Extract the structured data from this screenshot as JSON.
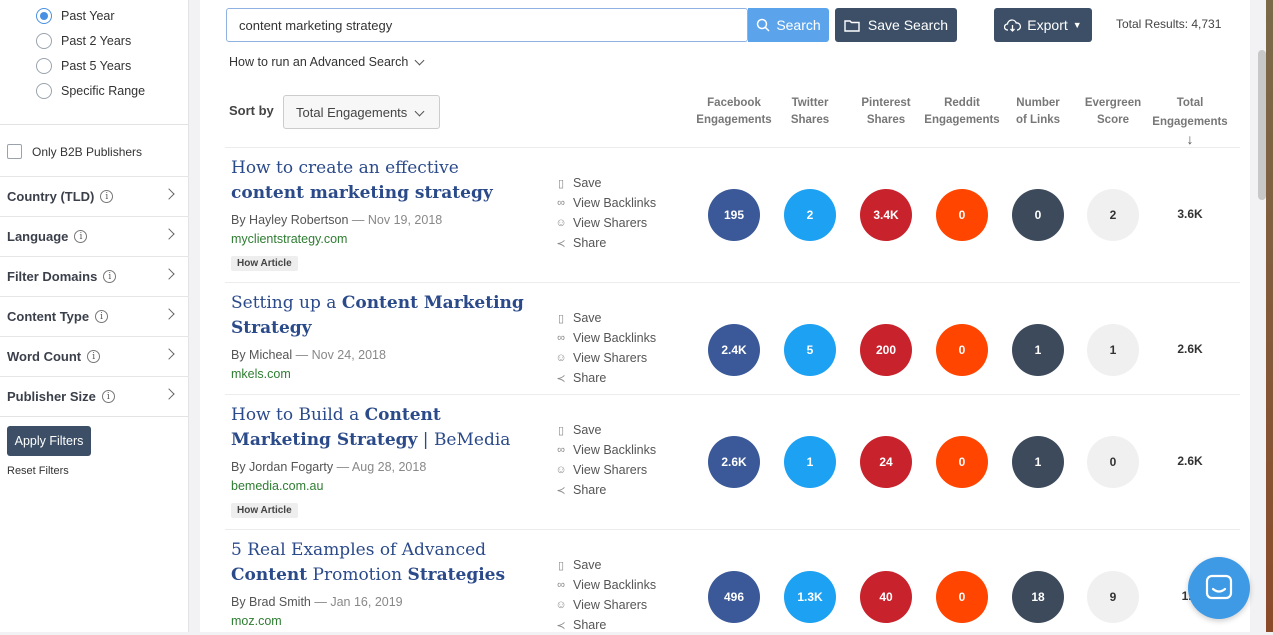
{
  "sidebar": {
    "date_options": [
      {
        "label": "Past Year",
        "checked": true
      },
      {
        "label": "Past 2 Years",
        "checked": false
      },
      {
        "label": "Past 5 Years",
        "checked": false
      },
      {
        "label": "Specific Range",
        "checked": false
      }
    ],
    "b2b_label": "Only B2B Publishers",
    "filters": [
      "Country (TLD)",
      "Language",
      "Filter Domains",
      "Content Type",
      "Word Count",
      "Publisher Size"
    ],
    "apply_label": "Apply Filters",
    "reset_label": "Reset Filters"
  },
  "search": {
    "query": "content marketing strategy",
    "search_label": "Search",
    "save_search_label": "Save Search",
    "export_label": "Export",
    "total_results": "Total Results: 4,731",
    "advanced_label": "How to run an Advanced Search"
  },
  "sort": {
    "label": "Sort by",
    "selected": "Total Engagements"
  },
  "columns": [
    {
      "line1": "Facebook",
      "line2": "Engagements"
    },
    {
      "line1": "Twitter",
      "line2": "Shares"
    },
    {
      "line1": "Pinterest",
      "line2": "Shares"
    },
    {
      "line1": "Reddit",
      "line2": "Engagements"
    },
    {
      "line1": "Number",
      "line2": "of Links"
    },
    {
      "line1": "Evergreen",
      "line2": "Score"
    },
    {
      "line1": "Total",
      "line2": "Engagements"
    }
  ],
  "actions": [
    "Save",
    "View Backlinks",
    "View Sharers",
    "Share"
  ],
  "results": [
    {
      "title_parts": [
        {
          "t": "How to create an effective ",
          "b": false
        },
        {
          "t": "content marketing strategy",
          "b": true
        }
      ],
      "author": "By Hayley Robertson",
      "date": "— Nov 19, 2018",
      "domain": "myclientstrategy.com",
      "tag": "How Article",
      "metrics": [
        "195",
        "2",
        "3.4K",
        "0",
        "0",
        "2",
        "3.6K"
      ]
    },
    {
      "title_parts": [
        {
          "t": "Setting up a ",
          "b": false
        },
        {
          "t": "Content Marketing Strategy",
          "b": true
        }
      ],
      "author": "By Micheal",
      "date": "— Nov 24, 2018",
      "domain": "mkels.com",
      "tag": "",
      "metrics": [
        "2.4K",
        "5",
        "200",
        "0",
        "1",
        "1",
        "2.6K"
      ]
    },
    {
      "title_parts": [
        {
          "t": "How to Build a ",
          "b": false
        },
        {
          "t": "Content Marketing Strategy",
          "b": true
        },
        {
          "t": " | BeMedia",
          "b": false
        }
      ],
      "author": "By Jordan Fogarty",
      "date": "— Aug 28, 2018",
      "domain": "bemedia.com.au",
      "tag": "How Article",
      "metrics": [
        "2.6K",
        "1",
        "24",
        "0",
        "1",
        "0",
        "2.6K"
      ]
    },
    {
      "title_parts": [
        {
          "t": "5 Real Examples of Advanced ",
          "b": false
        },
        {
          "t": "Content",
          "b": true
        },
        {
          "t": " Promotion ",
          "b": false
        },
        {
          "t": "Strategies",
          "b": true
        }
      ],
      "author": "By Brad Smith",
      "date": "— Jan 16, 2019",
      "domain": "moz.com",
      "tag": "",
      "metrics": [
        "496",
        "1.3K",
        "40",
        "0",
        "18",
        "9",
        "1.8"
      ]
    }
  ],
  "colors": {
    "facebook": "#3b5998",
    "twitter": "#1da1f2",
    "pinterest": "#c8232c",
    "reddit": "#ff4500",
    "links": "#3c4a5c",
    "evergreen": "#f0f0f0",
    "primary_button": "#3c4f66",
    "search_button": "#5ba4ec",
    "title_link": "#2b4a8a",
    "domain_link": "#2e7d32"
  },
  "icons": {
    "search": "magnifier-icon",
    "save_search": "folder-icon",
    "export": "cloud-download-icon",
    "chat": "chat-icon"
  }
}
